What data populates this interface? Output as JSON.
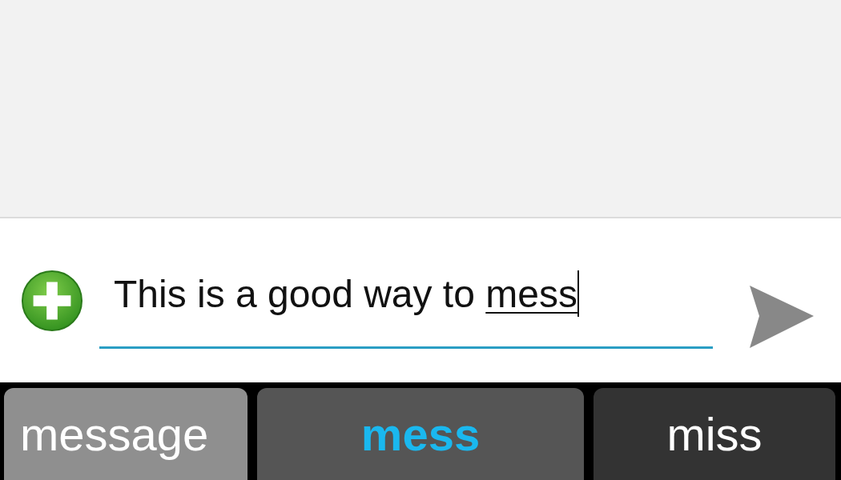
{
  "compose": {
    "value": "This is a good way to ",
    "composing": "mess"
  },
  "suggestions": [
    {
      "label": "message",
      "selected": false,
      "color": "#8f8f8f"
    },
    {
      "label": "mess",
      "selected": true,
      "color": "#555555"
    },
    {
      "label": "miss",
      "selected": false,
      "color": "#333333"
    }
  ]
}
